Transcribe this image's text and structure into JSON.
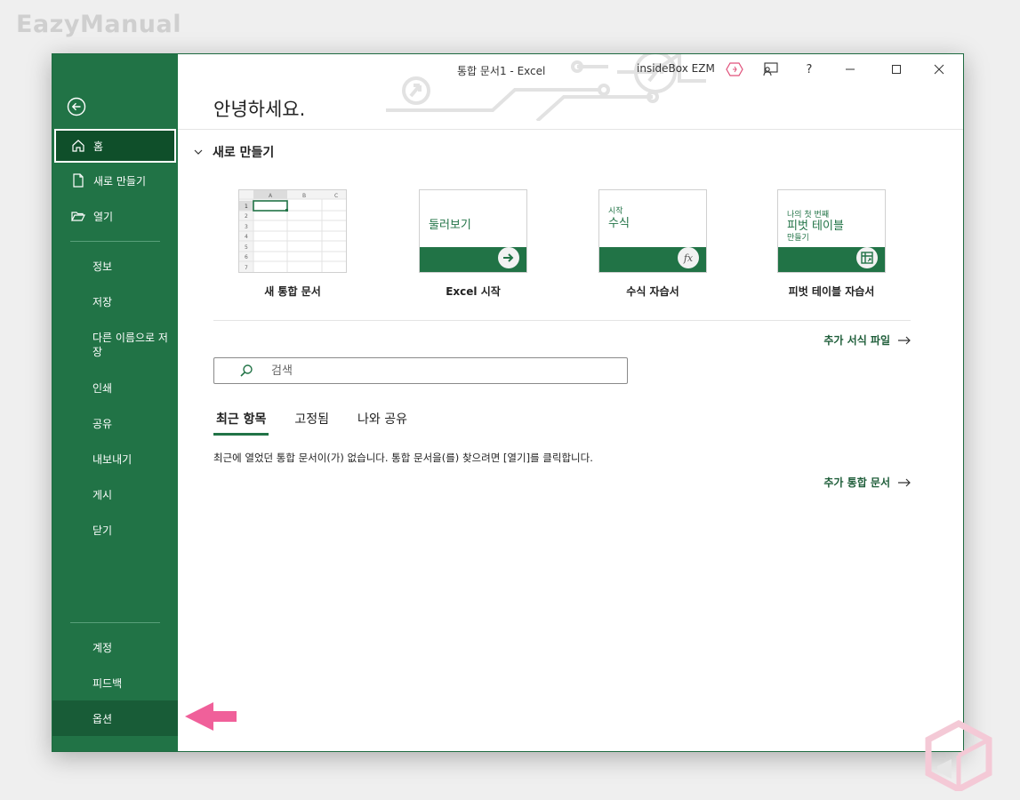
{
  "watermark": "EazyManual",
  "titlebar": {
    "doc_title": "통합 문서1  -  Excel",
    "user": "insideBox EZM",
    "help": "?"
  },
  "sidebar": {
    "home": "홈",
    "new": "새로 만들기",
    "open": "열기",
    "info": "정보",
    "save": "저장",
    "save_as": "다른 이름으로 저장",
    "print": "인쇄",
    "share": "공유",
    "export": "내보내기",
    "publish": "게시",
    "close": "닫기",
    "account": "계정",
    "feedback": "피드백",
    "options": "옵션"
  },
  "greeting": "안녕하세요.",
  "new_section": {
    "title": "새로 만들기",
    "templates": [
      {
        "label": "새 통합 문서"
      },
      {
        "label": "Excel 시작",
        "thumb_text": "둘러보기"
      },
      {
        "label": "수식 자습서",
        "thumb_small": "시작",
        "thumb_big": "수식",
        "thumb_icon": "fx"
      },
      {
        "label": "피벗 테이블 자습서",
        "thumb_small": "나의 첫 번째",
        "thumb_big": "피벗 테이블",
        "thumb_sub": "만들기"
      }
    ],
    "more_templates": "추가 서식 파일"
  },
  "search": {
    "placeholder": "검색"
  },
  "tabs": [
    "최근 항목",
    "고정됨",
    "나와 공유"
  ],
  "empty_message": "최근에 열었던 통합 문서이(가) 없습니다. 통합 문서을(를) 찾으려면 [열기]를 클릭합니다.",
  "more_workbooks": "추가 통합 문서",
  "colors": {
    "excel_green": "#217346",
    "annotation_arrow": "#f0609a"
  }
}
